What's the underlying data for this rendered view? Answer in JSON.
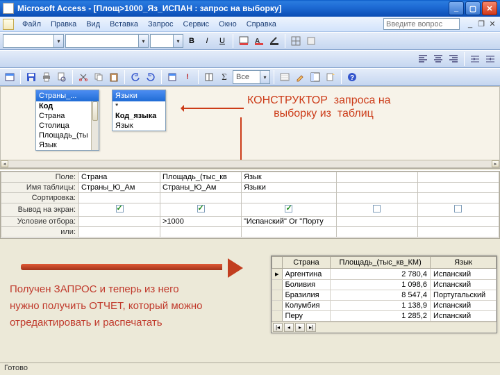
{
  "titlebar": {
    "title": "Microsoft Access - [Площ>1000_Яз_ИСПАН : запрос на выборку]"
  },
  "menubar": {
    "items": [
      "Файл",
      "Правка",
      "Вид",
      "Вставка",
      "Запрос",
      "Сервис",
      "Окно",
      "Справка"
    ],
    "help_placeholder": "Введите вопрос"
  },
  "toolbars": {
    "font_combo": "",
    "size_combo": "",
    "sigma_label": "Σ",
    "all_label": "Все"
  },
  "design": {
    "tables": [
      {
        "title": "Страны_...",
        "fields": [
          "Код",
          "Страна",
          "Столица",
          "Площадь_(ты",
          "Язык"
        ],
        "key_index": 0
      },
      {
        "title": "Языки",
        "fields": [
          "*",
          "Код_языка",
          "Язык"
        ],
        "key_index": 1
      }
    ],
    "annotation": "КОНСТРУКТОР  запроса на\n   выборку из  таблиц"
  },
  "qbe": {
    "row_labels": [
      "Поле:",
      "Имя таблицы:",
      "Сортировка:",
      "Вывод на экран:",
      "Условие отбора:",
      "или:"
    ],
    "columns": [
      {
        "field": "Страна",
        "table": "Страны_Ю_Ам",
        "show": true,
        "criteria": ""
      },
      {
        "field": "Площадь_(тыс_кв",
        "table": "Страны_Ю_Ам",
        "show": true,
        "criteria": ">1000"
      },
      {
        "field": "Язык",
        "table": "Языки",
        "show": true,
        "criteria": "\"Испанский\" Or \"Порту"
      },
      {
        "field": "",
        "table": "",
        "show": false,
        "criteria": ""
      },
      {
        "field": "",
        "table": "",
        "show": false,
        "criteria": ""
      }
    ]
  },
  "bottom_annotation": {
    "line1": "Получен ЗАПРОС и теперь из него",
    "line2": "нужно получить ОТЧЕТ,  который  можно",
    "line3": "отредактировать и  распечатать"
  },
  "datasheet": {
    "headers": [
      "Страна",
      "Площадь_(тыс_кв_КМ)",
      "Язык"
    ],
    "rows": [
      [
        "Аргентина",
        "2 780,4",
        "Испанский"
      ],
      [
        "Боливия",
        "1 098,6",
        "Испанский"
      ],
      [
        "Бразилия",
        "8 547,4",
        "Португальский"
      ],
      [
        "Колумбия",
        "1 138,9",
        "Испанский"
      ],
      [
        "Перу",
        "1 285,2",
        "Испанский"
      ]
    ]
  },
  "statusbar": {
    "text": "Готово"
  }
}
